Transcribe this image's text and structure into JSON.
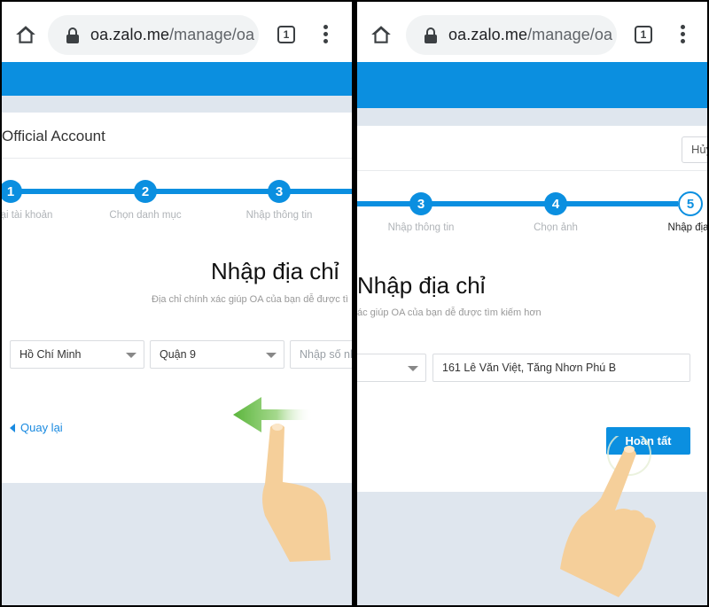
{
  "browser": {
    "url_host": "oa.zalo.me",
    "url_path": "/manage/oa",
    "tab_count": "1",
    "icons": {
      "home": "home-icon",
      "lock": "lock-icon",
      "tabs": "tab-switcher-icon",
      "menu": "more-vert-icon"
    }
  },
  "colors": {
    "brand_blue": "#0b8fe0",
    "page_bg": "#dfe6ee",
    "link_blue": "#1a8ae0",
    "hand_skin": "#f5cf9a",
    "arrow_green": "#6cbf4a"
  },
  "left_panel": {
    "page_title": "Official Account",
    "steps": [
      {
        "number": "1",
        "label": "Đăng ký lại tài khoản",
        "visible_label": "ại tài khoản",
        "state": "done"
      },
      {
        "number": "2",
        "label": "Chọn danh mục",
        "state": "done"
      },
      {
        "number": "3",
        "label": "Nhập thông tin",
        "state": "done"
      }
    ],
    "heading": "Nhập địa chỉ",
    "subtext": "Địa chỉ chính xác giúp OA của bạn dễ được tì",
    "city_select": "Hồ Chí Minh",
    "district_select": "Quận 9",
    "address_placeholder": "Nhập số nh",
    "back_label": "Quay lại",
    "gesture": "swipe-left"
  },
  "right_panel": {
    "cancel_label": "Hủy",
    "steps": [
      {
        "number": "3",
        "label": "Nhập thông tin",
        "state": "done"
      },
      {
        "number": "4",
        "label": "Chọn ảnh",
        "state": "done"
      },
      {
        "number": "5",
        "label": "Nhập địa c",
        "state": "current"
      }
    ],
    "heading": "Nhập địa chỉ",
    "subtext": "ác giúp OA của bạn dễ được tìm kiếm hơn",
    "address_value": "161 Lê Văn Việt, Tăng Nhơn Phú B",
    "done_label": "Hoàn tất",
    "gesture": "tap"
  }
}
